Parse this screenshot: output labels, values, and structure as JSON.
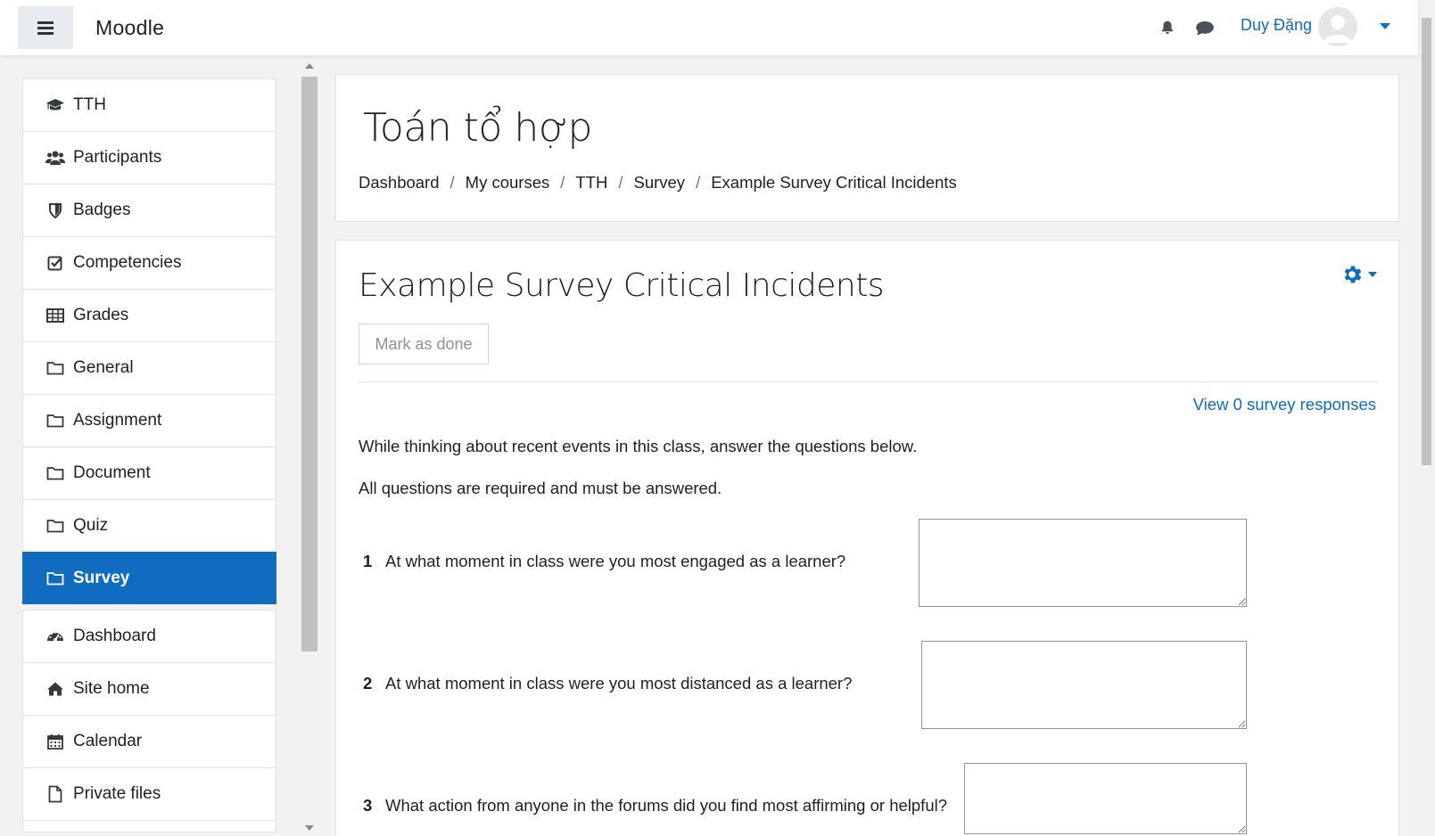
{
  "navbar": {
    "brand": "Moodle",
    "user_name": "Duy Đặng",
    "accent": "#0f6cbf"
  },
  "drawer": {
    "items": [
      {
        "label": "TTH",
        "icon": "graduation-cap-icon"
      },
      {
        "label": "Participants",
        "icon": "users-icon"
      },
      {
        "label": "Badges",
        "icon": "shield-icon"
      },
      {
        "label": "Competencies",
        "icon": "check-square-icon"
      },
      {
        "label": "Grades",
        "icon": "table-icon"
      },
      {
        "label": "General",
        "icon": "folder-icon"
      },
      {
        "label": "Assignment",
        "icon": "folder-icon"
      },
      {
        "label": "Document",
        "icon": "folder-icon"
      },
      {
        "label": "Quiz",
        "icon": "folder-icon"
      },
      {
        "label": "Survey",
        "icon": "folder-icon",
        "active": true
      }
    ],
    "items2": [
      {
        "label": "Dashboard",
        "icon": "dashboard-icon"
      },
      {
        "label": "Site home",
        "icon": "home-icon"
      },
      {
        "label": "Calendar",
        "icon": "calendar-icon"
      },
      {
        "label": "Private files",
        "icon": "file-icon"
      }
    ]
  },
  "header": {
    "course_title": "Toán tổ hợp",
    "breadcrumb": [
      "Dashboard",
      "My courses",
      "TTH",
      "Survey",
      "Example Survey Critical Incidents"
    ]
  },
  "main": {
    "activity_title": "Example Survey Critical Incidents",
    "mark_done_label": "Mark as done",
    "view_responses": "View 0 survey responses",
    "intro1": "While thinking about recent events in this class, answer the questions below.",
    "intro2": "All questions are required and must be answered.",
    "questions": [
      {
        "num": "1",
        "text": "At what moment in class were you most engaged as a learner?"
      },
      {
        "num": "2",
        "text": "At what moment in class were you most distanced as a learner?"
      },
      {
        "num": "3",
        "text": "What action from anyone in the forums did you find most affirming or helpful?"
      }
    ]
  }
}
